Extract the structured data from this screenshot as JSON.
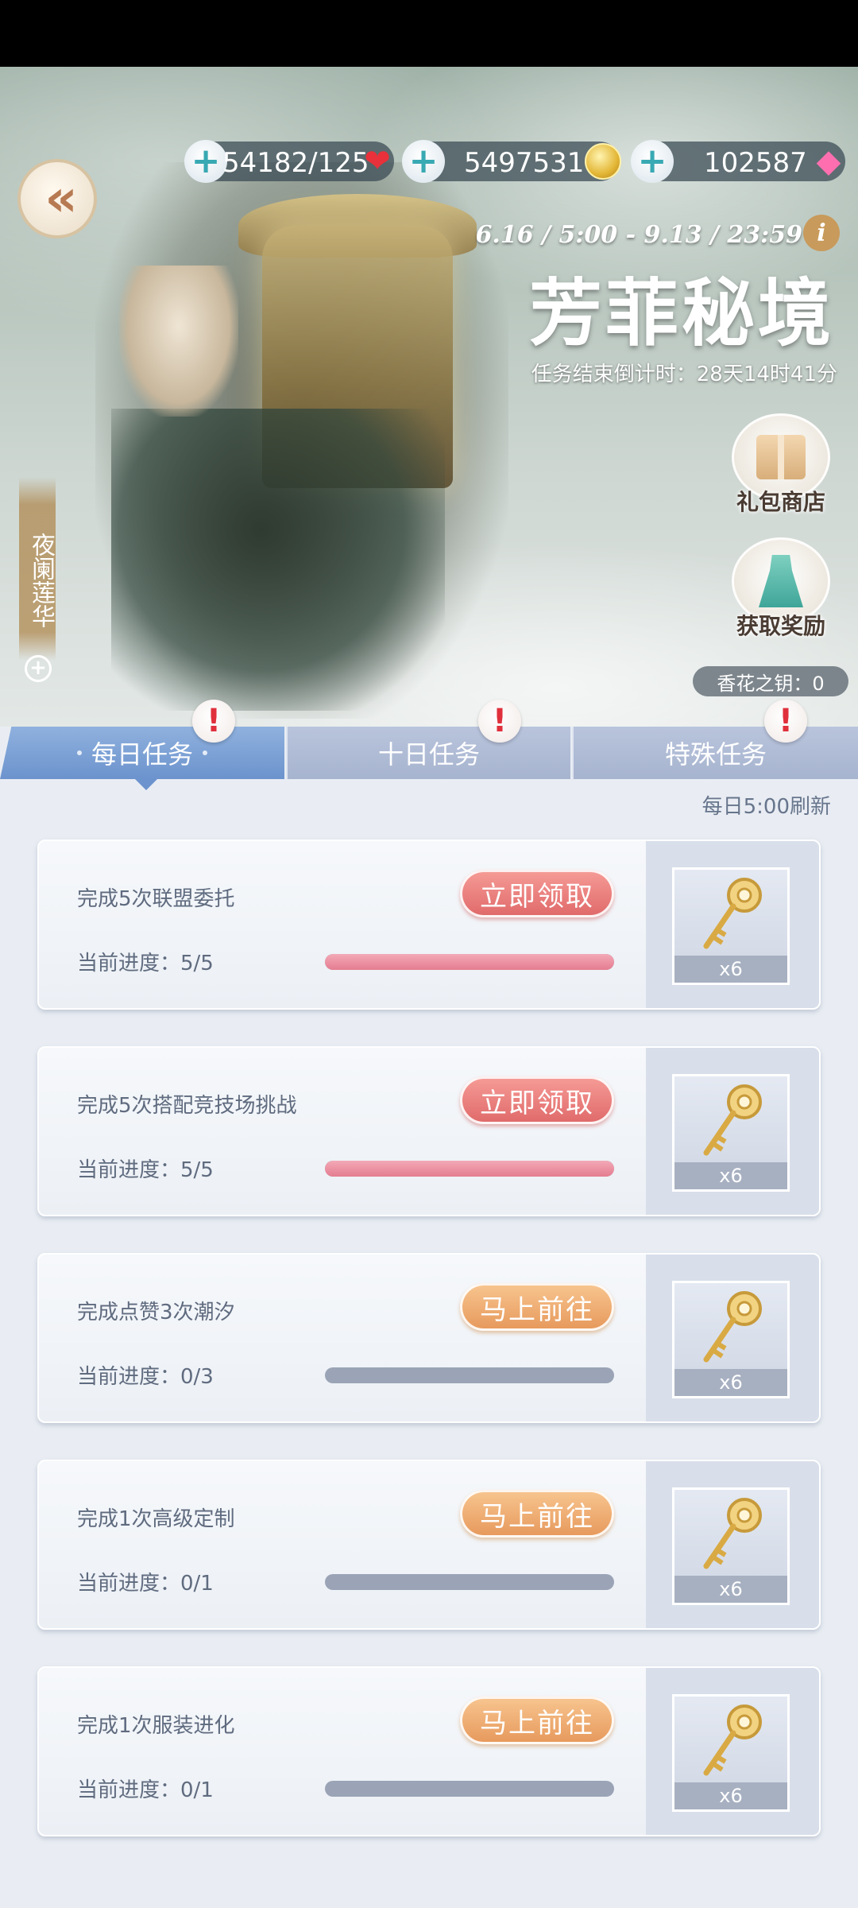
{
  "header": {
    "resources": [
      {
        "value": "54182/125",
        "icon": "heart-icon"
      },
      {
        "value": "5497531",
        "icon": "gold-coin-icon"
      },
      {
        "value": "102587",
        "icon": "diamond-icon"
      }
    ],
    "dates": "6.16 / 5:00 - 9.13 / 23:59",
    "title": "芳菲秘境",
    "countdown": "任务结束倒计时：28天14时41分"
  },
  "side": {
    "gift_shop": "礼包商店",
    "get_rewards": "获取奖励",
    "key_count": "香花之钥：0",
    "outfit_name": "夜阑莲华"
  },
  "tabs": [
    {
      "label": "每日任务",
      "active": true
    },
    {
      "label": "十日任务",
      "active": false
    },
    {
      "label": "特殊任务",
      "active": false
    }
  ],
  "refresh_note": "每日5:00刷新",
  "tasks": [
    {
      "name": "完成5次联盟委托",
      "progress_label": "当前进度：5/5",
      "progress": 1.0,
      "action": "立即领取",
      "reward_qty": "x6"
    },
    {
      "name": "完成5次搭配竞技场挑战",
      "progress_label": "当前进度：5/5",
      "progress": 1.0,
      "action": "立即领取",
      "reward_qty": "x6"
    },
    {
      "name": "完成点赞3次潮汐",
      "progress_label": "当前进度：0/3",
      "progress": 0.0,
      "action": "马上前往",
      "reward_qty": "x6"
    },
    {
      "name": "完成1次高级定制",
      "progress_label": "当前进度：0/1",
      "progress": 0.0,
      "action": "马上前往",
      "reward_qty": "x6"
    },
    {
      "name": "完成1次服装进化",
      "progress_label": "当前进度：0/1",
      "progress": 0.0,
      "action": "马上前往",
      "reward_qty": "x6"
    }
  ],
  "colors": {
    "claim": "#e06b6b",
    "goto": "#e79a5d",
    "tab_active": "#6c93cd"
  }
}
